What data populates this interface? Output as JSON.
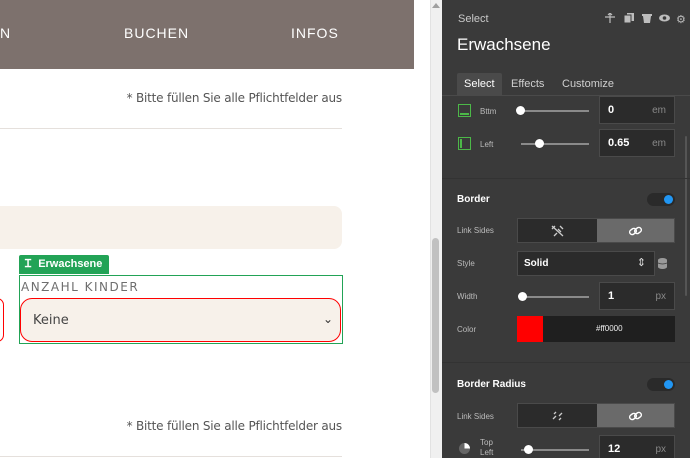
{
  "website": {
    "nav": [
      "N",
      "BUCHEN",
      "INFOS"
    ],
    "required_note": "* Bitte füllen Sie alle Pflichtfelder aus",
    "selected_tag": "Erwachsene",
    "kinder_label": "ANZAHL KINDER",
    "kinder_value": "Keine"
  },
  "panel": {
    "kicker": "Select",
    "title": "Erwachsene",
    "tabs": [
      "Select",
      "Effects",
      "Customize"
    ],
    "padding": {
      "bottom": {
        "label": "Bttm",
        "value": "0",
        "unit": "em"
      },
      "left": {
        "label": "Left",
        "value": "0.65",
        "unit": "em"
      }
    },
    "border": {
      "title": "Border",
      "link_sides_label": "Link Sides",
      "style_label": "Style",
      "style_value": "Solid",
      "width_label": "Width",
      "width_value": "1",
      "width_unit": "px",
      "color_label": "Color",
      "color_value": "#ff0000"
    },
    "border_radius": {
      "title": "Border Radius",
      "link_sides_label": "Link Sides",
      "top_left_label": "Top Left",
      "top_left_value": "12",
      "top_left_unit": "px"
    }
  },
  "colors": {
    "nav_bg": "#7d716d",
    "field_bg": "#f7f1ea",
    "selection": "#22a356",
    "panel_bg": "#3a3a3a",
    "accent_blue": "#2196f3",
    "border_red": "#ff0000"
  },
  "icons": [
    "move-icon",
    "copy-icon",
    "trash-icon",
    "eye-icon",
    "gear-icon",
    "unlink-icon",
    "link-icon",
    "database-icon",
    "chevron-down-icon",
    "radius-corner-icon"
  ]
}
